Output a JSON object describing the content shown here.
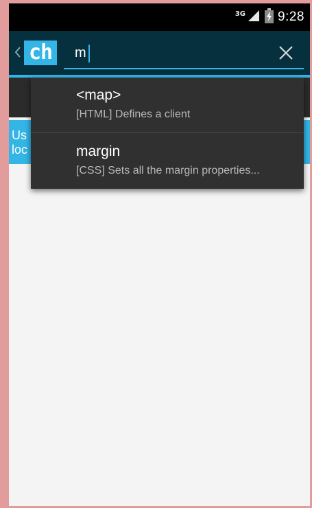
{
  "status_bar": {
    "network_label": "3G",
    "time": "9:28",
    "icons": [
      "signal-icon",
      "battery-icon"
    ]
  },
  "app": {
    "logo_text": "ch",
    "back_icon": "chevron-left-icon",
    "clear_icon": "close-icon"
  },
  "search": {
    "value": "m",
    "placeholder": ""
  },
  "info_bar": {
    "line1": "Us",
    "line2": "loc"
  },
  "suggestions": [
    {
      "title": "<map>",
      "subtitle": "[HTML] Defines a client"
    },
    {
      "title": "margin",
      "subtitle": "[CSS] Sets all the margin properties..."
    }
  ],
  "colors": {
    "accent": "#33b5e5",
    "action_bar": "#07303f",
    "dropdown": "#303030",
    "frame": "#e39c9c"
  }
}
